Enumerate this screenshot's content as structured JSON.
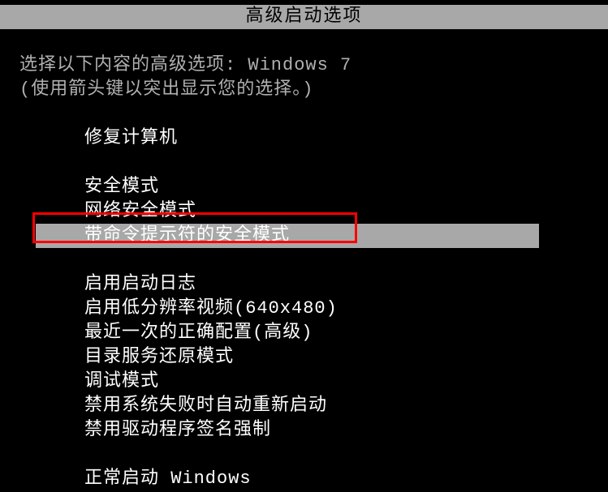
{
  "title": "高级启动选项",
  "instruction_line1_prefix": "选择以下内容的高级选项: ",
  "instruction_line1_os": "Windows 7",
  "instruction_line2": "(使用箭头键以突出显示您的选择。)",
  "menu": {
    "repair": "修复计算机",
    "safe_mode": "安全模式",
    "safe_mode_network": "网络安全模式",
    "safe_mode_cmd": "带命令提示符的安全模式",
    "boot_logging": "启用启动日志",
    "low_res": "启用低分辨率视频(640x480)",
    "last_known_good": "最近一次的正确配置(高级)",
    "ds_restore": "目录服务还原模式",
    "debug_mode": "调试模式",
    "disable_auto_restart": "禁用系统失败时自动重新启动",
    "disable_driver_sig": "禁用驱动程序签名强制",
    "start_normally_prefix": "正常启动 ",
    "start_normally_os": "Windows"
  }
}
